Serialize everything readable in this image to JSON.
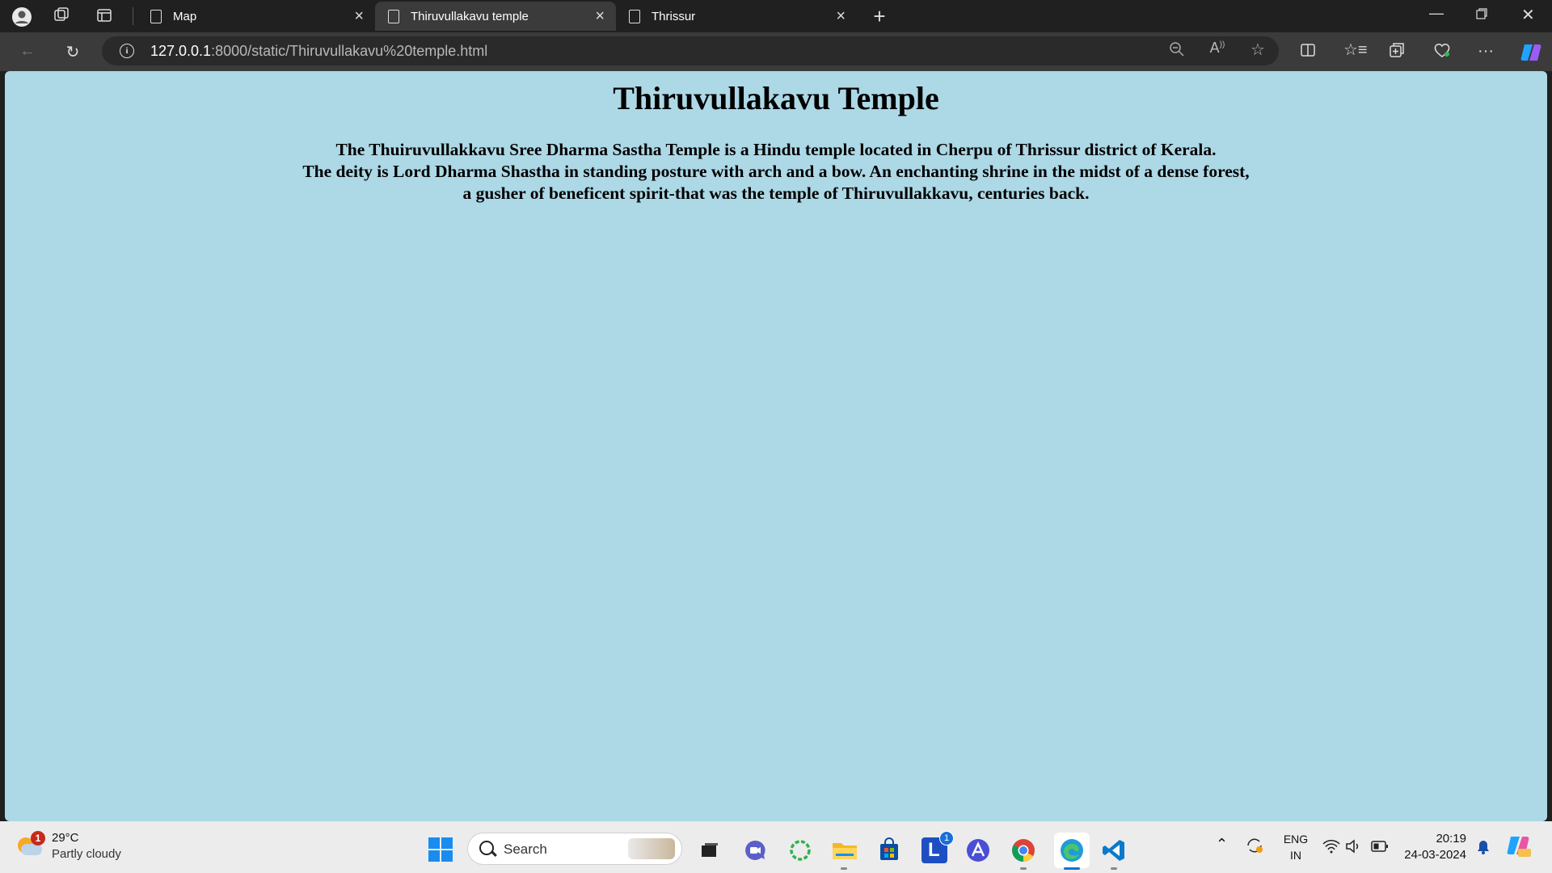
{
  "browser": {
    "tabs": [
      {
        "title": "Map",
        "active": false
      },
      {
        "title": "Thiruvullakavu temple",
        "active": true
      },
      {
        "title": "Thrissur",
        "active": false
      }
    ],
    "url_host": "127.0.0.1",
    "url_rest": ":8000/static/Thiruvullakavu%20temple.html"
  },
  "page": {
    "heading": "Thiruvullakavu Temple",
    "paragraph_lines": [
      "The Thuiruvullakkavu Sree Dharma Sastha Temple is a Hindu temple located in Cherpu of Thrissur district of Kerala.",
      "The deity is Lord Dharma Shastha in standing posture with arch and a bow. An enchanting shrine in the midst of a dense forest,",
      "a gusher of beneficent spirit-that was the temple of Thiruvullakkavu, centuries back."
    ],
    "background": "#add8e6"
  },
  "taskbar": {
    "weather_badge": "1",
    "temperature": "29°C",
    "condition": "Partly cloudy",
    "search_label": "Search",
    "lang_line1": "ENG",
    "lang_line2": "IN",
    "time": "20:19",
    "date": "24-03-2024",
    "l_app_badge": "1",
    "l_app_letter": "L"
  },
  "colors": {
    "accent": "#1a8cf0",
    "chrome_dark": "#202020",
    "toolbar": "#3b3b3b"
  }
}
